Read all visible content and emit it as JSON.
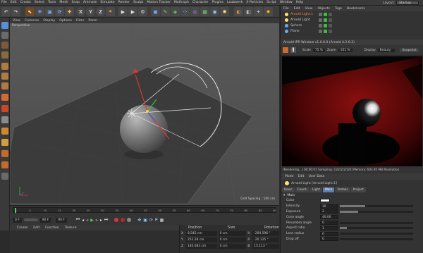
{
  "menubar": {
    "items": [
      "File",
      "Edit",
      "Create",
      "Select",
      "Tools",
      "Mesh",
      "Snap",
      "Animate",
      "Simulate",
      "Render",
      "Sculpt",
      "Motion Tracker",
      "MoGraph",
      "Character",
      "Plugins",
      "Laubwerk",
      "X-Particles",
      "Script",
      "Window",
      "Help"
    ],
    "layout_label": "Layout:",
    "layout_value": "Startup"
  },
  "viewport": {
    "menu": [
      "View",
      "Cameras",
      "Display",
      "Options",
      "Filter",
      "Panel"
    ],
    "label": "Perspective",
    "grid_spacing": "Grid Spacing : 100 cm"
  },
  "timeline": {
    "ticks": [
      "0",
      "5",
      "10",
      "15",
      "20",
      "25",
      "30",
      "35",
      "40",
      "45",
      "50",
      "55",
      "60",
      "65",
      "70",
      "75",
      "80",
      "85",
      "90"
    ],
    "frame_start": "0 F",
    "frame_field": "0 F",
    "frame_end": "90 F",
    "frame_end2": "90 F",
    "current": "0 F"
  },
  "material_manager": {
    "menu": [
      "Create",
      "Edit",
      "Function",
      "Texture"
    ]
  },
  "coordinates": {
    "headers": [
      "Position",
      "Size",
      "Rotation"
    ],
    "rows": [
      {
        "axis": "X",
        "pos": "8.545 cm",
        "size": "0 cm",
        "rot_label": "H",
        "rot": "-200.596 °"
      },
      {
        "axis": "Y",
        "pos": "252.28 cm",
        "size": "0 cm",
        "rot_label": "P",
        "rot": "-20.125 °"
      },
      {
        "axis": "Z",
        "pos": "140.083 cm",
        "size": "0 cm",
        "rot_label": "B",
        "rot": "15.113 °"
      }
    ]
  },
  "object_manager": {
    "menu": [
      "File",
      "Edit",
      "View",
      "Objects",
      "Tags",
      "Bookmarks"
    ],
    "objects": [
      {
        "name": "Arnold Light.1",
        "selected": true
      },
      {
        "name": "Arnold Light",
        "selected": false
      },
      {
        "name": "Sphere",
        "selected": false
      },
      {
        "name": "Plane",
        "selected": false
      }
    ]
  },
  "ipr": {
    "title": "Arnold IPR Window v1.0.0.0 (Arnold 4.2.6.2)",
    "scale_label": "Scale",
    "scale_value": "75 %",
    "zoom_label": "Zoom",
    "zoom_value": "101 %",
    "display_label": "Display",
    "display_value": "Beauty",
    "snapshot_label": "Snapshot",
    "status": "[Rendering...]   00:00:01   Sampling: [3/2/2/2/3/0]   Memory: 603.95 MB   Resolution"
  },
  "attributes": {
    "menu": [
      "Mode",
      "Edit",
      "User Data"
    ],
    "title": "Arnold Light [Arnold Light.1]",
    "tabs": [
      {
        "label": "Basic",
        "active": false
      },
      {
        "label": "Coord.",
        "active": false
      },
      {
        "label": "Light",
        "active": false
      },
      {
        "label": "Main",
        "active": true
      },
      {
        "label": "Details",
        "active": false
      },
      {
        "label": "Project",
        "active": false
      }
    ],
    "section": "Main",
    "rows": [
      {
        "label": "Color",
        "value": "",
        "kind": "swatch"
      },
      {
        "label": "Intensity",
        "value": "10",
        "fill": 0.35
      },
      {
        "label": "Exposure",
        "value": "2",
        "fill": 0.25
      },
      {
        "label": "Cone angle",
        "value": "40.00",
        "fill": null
      },
      {
        "label": "Penumbra angle",
        "value": "0",
        "fill": 0.0
      },
      {
        "label": "Aspect ratio",
        "value": "1",
        "fill": 0.1
      },
      {
        "label": "Lens radius",
        "value": "0",
        "fill": 0.0
      },
      {
        "label": "Drop off",
        "value": "0",
        "fill": 0.0
      }
    ]
  },
  "colors": {
    "accent": "#5b7fae",
    "axis_x": "#d9372f",
    "axis_y": "#3bbf3b",
    "axis_z": "#3a5fe0",
    "render_bg": "#7a0d0d"
  }
}
